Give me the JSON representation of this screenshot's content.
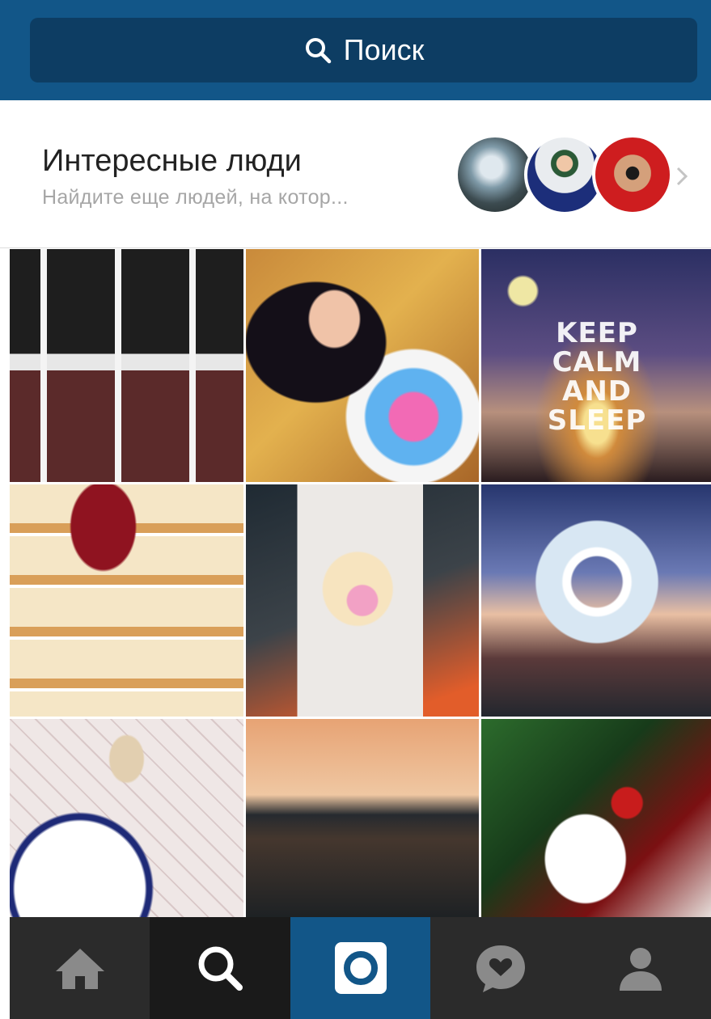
{
  "search": {
    "label": "Поиск",
    "icon": "search-icon"
  },
  "suggested": {
    "title": "Интересные люди",
    "subtitle": "Найдите еще людей, на котор...",
    "avatars": [
      "avatar-person-mountain",
      "avatar-person-cap",
      "avatar-person-goggles"
    ],
    "chevron_icon": "chevron-right-icon"
  },
  "grid": {
    "tiles": [
      {
        "name": "photo-bicycle"
      },
      {
        "name": "photo-woman-flowers"
      },
      {
        "name": "photo-keep-calm",
        "text": "KEEP\nCALM\nAND\nSLEEP"
      },
      {
        "name": "photo-pancakes"
      },
      {
        "name": "photo-phone-case"
      },
      {
        "name": "photo-sparkler-ring"
      },
      {
        "name": "photo-coffee-table"
      },
      {
        "name": "photo-sunset-lake"
      },
      {
        "name": "photo-table-setting"
      }
    ]
  },
  "tabbar": {
    "tabs": [
      {
        "icon": "home-icon",
        "active": false
      },
      {
        "icon": "search-icon",
        "active": true
      },
      {
        "icon": "camera-icon",
        "active": false
      },
      {
        "icon": "activity-heart-icon",
        "active": false
      },
      {
        "icon": "profile-icon",
        "active": false
      }
    ]
  },
  "colors": {
    "brand_blue": "#125688",
    "search_bg": "#0d3d63",
    "tabbar_bg": "#2b2b2b",
    "tab_active_bg": "#1a1a1a",
    "icon_gray": "#8a8a8a"
  }
}
